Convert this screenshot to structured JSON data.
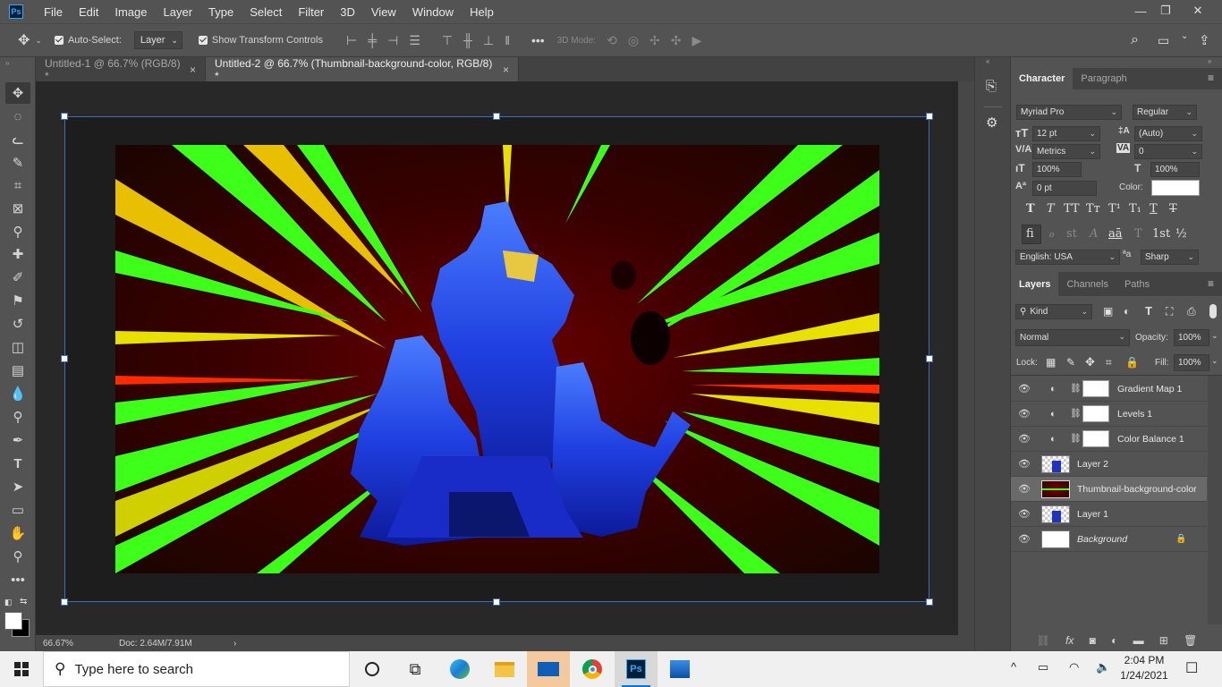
{
  "app": {
    "logo": "Ps"
  },
  "menu": [
    "File",
    "Edit",
    "Image",
    "Layer",
    "Type",
    "Select",
    "Filter",
    "3D",
    "View",
    "Window",
    "Help"
  ],
  "options": {
    "auto_select_label": "Auto-Select:",
    "auto_select_value": "Layer",
    "show_transform_label": "Show Transform Controls",
    "mode_3d_label": "3D Mode:"
  },
  "tabs": [
    {
      "label": "Untitled-1 @ 66.7% (RGB/8) *",
      "close": "×"
    },
    {
      "label": "Untitled-2 @ 66.7% (Thumbnail-background-color, RGB/8) *",
      "close": "×"
    }
  ],
  "status": {
    "zoom": "66.67%",
    "doc": "Doc: 2.64M/7.91M",
    "arrow": "›"
  },
  "character": {
    "tabs": [
      "Character",
      "Paragraph"
    ],
    "font_family": "Myriad Pro",
    "font_style": "Regular",
    "font_size": "12 pt",
    "leading": "(Auto)",
    "kerning": "Metrics",
    "tracking": "0",
    "vertical_scale": "100%",
    "horizontal_scale": "100%",
    "baseline_shift": "0 pt",
    "color_label": "Color:",
    "color_value": "#ffffff",
    "type_buttons": [
      "T",
      "T",
      "TT",
      "Tт",
      "T¹",
      "T₁",
      "T",
      "T"
    ],
    "opentype_buttons": [
      "fi",
      "ℴ",
      "st",
      "A",
      "aā",
      "T",
      "1st",
      "½"
    ],
    "language": "English: USA",
    "aa_label": "ªa",
    "antialias": "Sharp"
  },
  "layers_panel": {
    "tabs": [
      "Layers",
      "Channels",
      "Paths"
    ],
    "filter_label": "Kind",
    "blend_mode": "Normal",
    "opacity_label": "Opacity:",
    "opacity_value": "100%",
    "lock_label": "Lock:",
    "fill_label": "Fill:",
    "fill_value": "100%",
    "layers": [
      {
        "name": "Gradient Map 1",
        "type": "adjustment"
      },
      {
        "name": "Levels 1",
        "type": "adjustment"
      },
      {
        "name": "Color Balance 1",
        "type": "adjustment"
      },
      {
        "name": "Layer 2",
        "type": "pixel"
      },
      {
        "name": "Thumbnail-background-color",
        "type": "image",
        "selected": true
      },
      {
        "name": "Layer 1",
        "type": "pixel"
      },
      {
        "name": "Background",
        "type": "background",
        "locked": true
      }
    ]
  },
  "taskbar": {
    "search_placeholder": "Type here to search",
    "time": "2:04 PM",
    "date": "1/24/2021"
  },
  "colors": {
    "ui_bg": "#535353",
    "canvas_bg": "#282828",
    "selection_blue": "#3b6ec2",
    "ps_blue": "#31a8ff"
  }
}
